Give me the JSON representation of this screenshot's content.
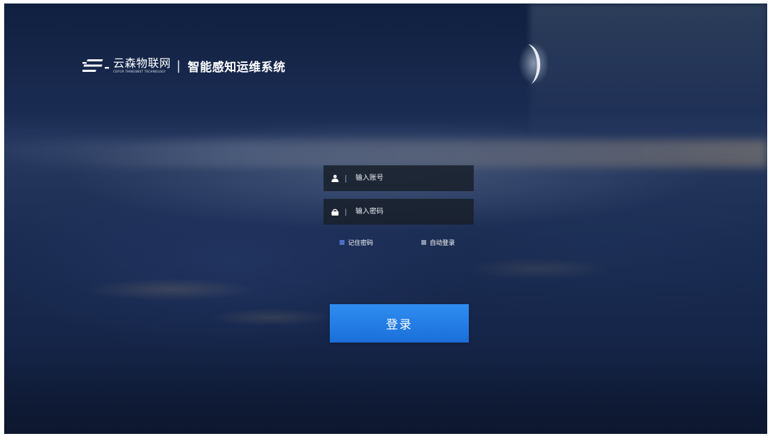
{
  "brand": {
    "name": "云森物联网",
    "subtitle": "COFOR THINGSNET TECHNOLOGY",
    "separator": "|",
    "system_title": "智能感知运维系统",
    "logo_icon": "cofor-logo-icon"
  },
  "login_form": {
    "account": {
      "icon": "user-icon",
      "divider": "|",
      "placeholder": "输入账号",
      "value": ""
    },
    "password": {
      "icon": "lock-icon",
      "divider": "|",
      "placeholder": "输入密码",
      "value": ""
    },
    "remember_password": {
      "label": "记住密码",
      "checked": true
    },
    "auto_login": {
      "label": "自动登录",
      "checked": false
    },
    "submit_label": "登录"
  },
  "colors": {
    "button": "#2379e0",
    "background": "#1b2c52",
    "field_background": "#19202a",
    "checkbox_checked": "#4f6fc6",
    "checkbox_unchecked": "#8a95aa"
  }
}
